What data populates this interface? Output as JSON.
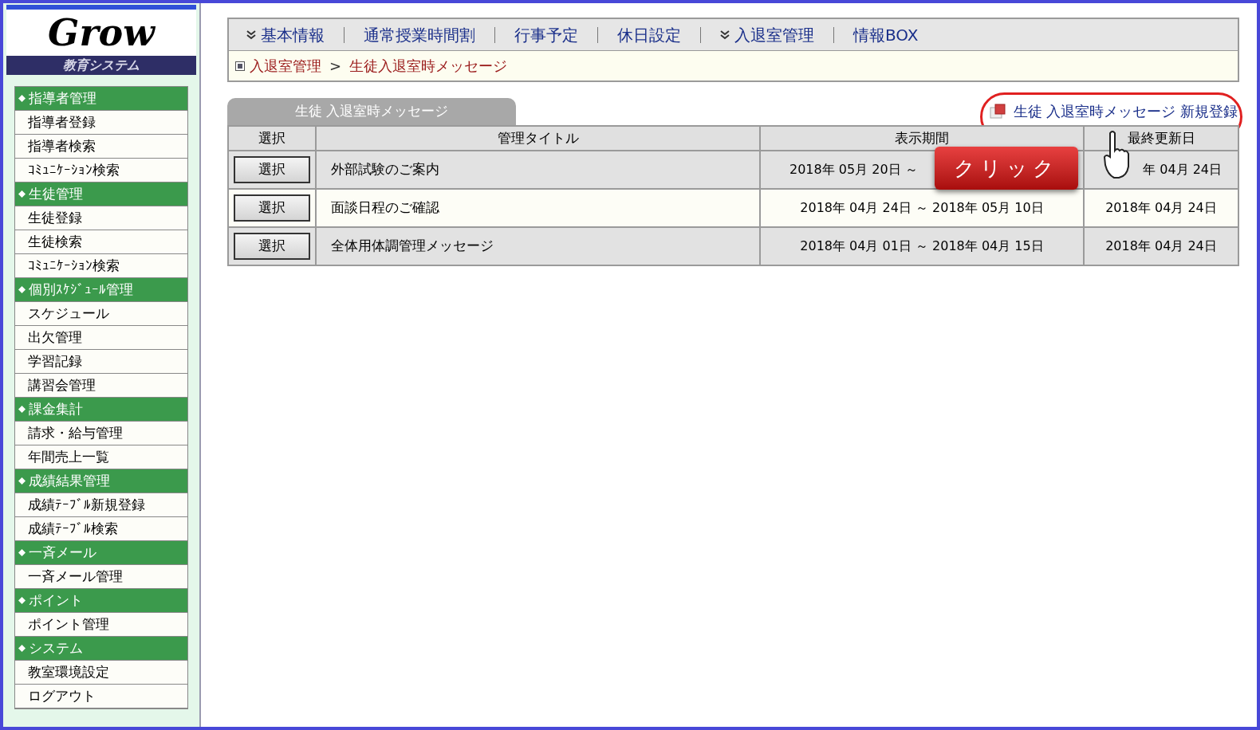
{
  "logo": {
    "name": "Grow",
    "subtitle": "教育システム"
  },
  "sidebar": [
    {
      "title": "指導者管理",
      "items": [
        "指導者登録",
        "指導者検索",
        "ｺﾐｭﾆｹｰｼｮﾝ検索"
      ]
    },
    {
      "title": "生徒管理",
      "items": [
        "生徒登録",
        "生徒検索",
        "ｺﾐｭﾆｹｰｼｮﾝ検索"
      ]
    },
    {
      "title": "個別ｽｹｼﾞｭｰﾙ管理",
      "items": [
        "スケジュール",
        "出欠管理",
        "学習記録",
        "講習会管理"
      ]
    },
    {
      "title": "課金集計",
      "items": [
        "請求・給与管理",
        "年間売上一覧"
      ]
    },
    {
      "title": "成績結果管理",
      "items": [
        "成績ﾃｰﾌﾞﾙ新規登録",
        "成績ﾃｰﾌﾞﾙ検索"
      ]
    },
    {
      "title": "一斉メール",
      "items": [
        "一斉メール管理"
      ]
    },
    {
      "title": "ポイント",
      "items": [
        "ポイント管理"
      ]
    },
    {
      "title": "システム",
      "items": [
        "教室環境設定",
        "ログアウト"
      ]
    }
  ],
  "top_nav": [
    {
      "label": "基本情報",
      "dropdown": true
    },
    {
      "label": "通常授業時間割",
      "dropdown": false
    },
    {
      "label": "行事予定",
      "dropdown": false
    },
    {
      "label": "休日設定",
      "dropdown": false
    },
    {
      "label": "入退室管理",
      "dropdown": true
    },
    {
      "label": "情報BOX",
      "dropdown": false
    }
  ],
  "breadcrumb": {
    "parent": "入退室管理",
    "separator": ">",
    "current": "生徒入退室時メッセージ"
  },
  "panel_tab": "生徒 入退室時メッセージ",
  "new_link": "生徒 入退室時メッセージ 新規登録",
  "callout": "クリック",
  "table": {
    "columns": [
      "選択",
      "管理タイトル",
      "表示期間",
      "最終更新日"
    ],
    "rows": [
      {
        "button": "選択",
        "title": "外部試験のご案内",
        "period": "2018年 05月 20日 ～",
        "updated": "年 04月 24日"
      },
      {
        "button": "選択",
        "title": "面談日程のご確認",
        "period": "2018年 04月 24日 ～ 2018年 05月 10日",
        "updated": "2018年 04月 24日"
      },
      {
        "button": "選択",
        "title": "全体用体調管理メッセージ",
        "period": "2018年 04月 01日 ～ 2018年 04月 15日",
        "updated": "2018年 04月 24日"
      }
    ]
  }
}
